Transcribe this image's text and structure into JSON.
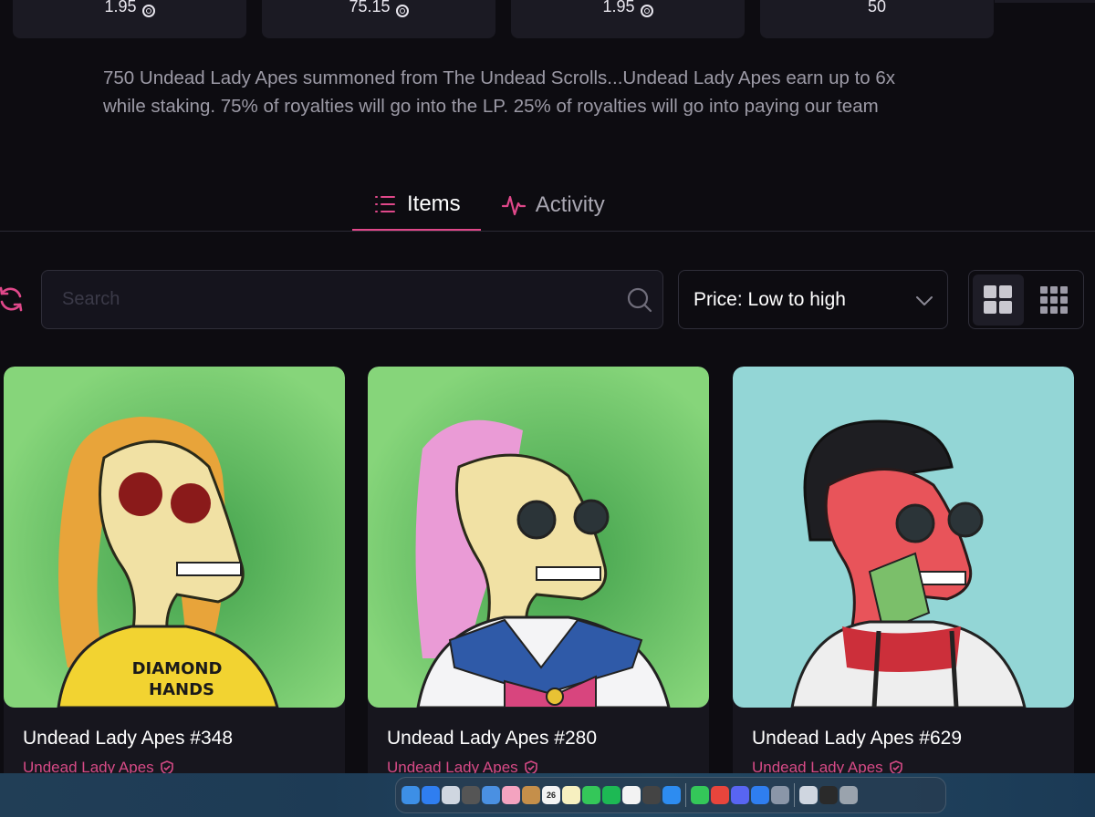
{
  "stats": [
    {
      "value": "1.95",
      "has_coin": true
    },
    {
      "value": "75.15",
      "has_coin": true
    },
    {
      "value": "1.95",
      "has_coin": true
    },
    {
      "value": "50",
      "has_coin": false
    }
  ],
  "description": "750 Undead Lady Apes summoned from The Undead Scrolls...Undead Lady Apes earn up to 6x while staking. 75% of royalties will go into the LP. 25% of royalties will go into paying our team",
  "tabs": [
    {
      "label": "Items",
      "icon": "list-icon",
      "active": true
    },
    {
      "label": "Activity",
      "icon": "activity-icon",
      "active": false
    }
  ],
  "search": {
    "placeholder": "Search",
    "value": ""
  },
  "sort": {
    "selected": "Price: Low to high"
  },
  "view_modes": [
    {
      "name": "large-grid",
      "active": true
    },
    {
      "name": "small-grid",
      "active": false
    }
  ],
  "cards": [
    {
      "title": "Undead Lady Apes #348",
      "collection": "Undead Lady Apes",
      "bg": "#7fcf74",
      "shirt_text_line1": "DIAMOND",
      "shirt_text_line2": "HANDS"
    },
    {
      "title": "Undead Lady Apes #280",
      "collection": "Undead Lady Apes",
      "bg": "#7fcf74"
    },
    {
      "title": "Undead Lady Apes #629",
      "collection": "Undead Lady Apes",
      "bg": "#93d6d6"
    }
  ],
  "dock": {
    "calendar_day": "26"
  },
  "colors": {
    "accent": "#e0488a",
    "background": "#0d0c11",
    "card": "#17161e"
  }
}
